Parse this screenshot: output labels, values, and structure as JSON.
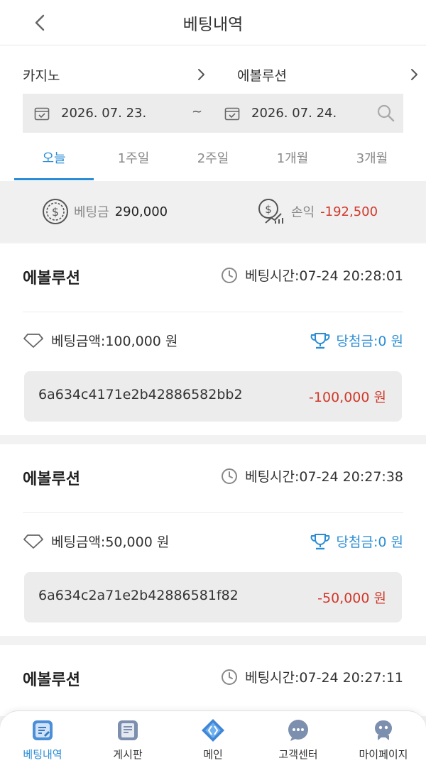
{
  "header": {
    "title": "베팅내역"
  },
  "filters": {
    "category_left": "카지노",
    "category_right": "에볼루션",
    "date_from": "2026. 07. 23.",
    "date_separator": "~",
    "date_to": "2026. 07. 24."
  },
  "tabs": [
    {
      "label": "오늘",
      "active": true
    },
    {
      "label": "1주일"
    },
    {
      "label": "2주일"
    },
    {
      "label": "1개월"
    },
    {
      "label": "3개월"
    }
  ],
  "summary": {
    "bet_label": "베팅금",
    "bet_value": "290,000",
    "profit_label": "손익",
    "profit_value": "-192,500"
  },
  "records": [
    {
      "game": "에볼루션",
      "time": "베팅시간:07-24 20:28:01",
      "amount": "베팅금액:100,000 원",
      "win": "당첨금:0 원",
      "hash": "6a634c4171e2b42886582bb2",
      "pl": "-100,000 원"
    },
    {
      "game": "에볼루션",
      "time": "베팅시간:07-24 20:27:38",
      "amount": "베팅금액:50,000 원",
      "win": "당첨금:0 원",
      "hash": "6a634c2a71e2b42886581f82",
      "pl": "-50,000 원"
    },
    {
      "game": "에볼루션",
      "time": "베팅시간:07-24 20:27:11"
    }
  ],
  "nav": [
    {
      "label": "베팅내역",
      "icon": "bet-history-icon",
      "active": true
    },
    {
      "label": "게시판",
      "icon": "board-icon"
    },
    {
      "label": "메인",
      "icon": "main-icon"
    },
    {
      "label": "고객센터",
      "icon": "chat-icon"
    },
    {
      "label": "마이페이지",
      "icon": "mypage-icon"
    }
  ],
  "colors": {
    "accent": "#2a8dd4",
    "negative": "#d0392b"
  }
}
